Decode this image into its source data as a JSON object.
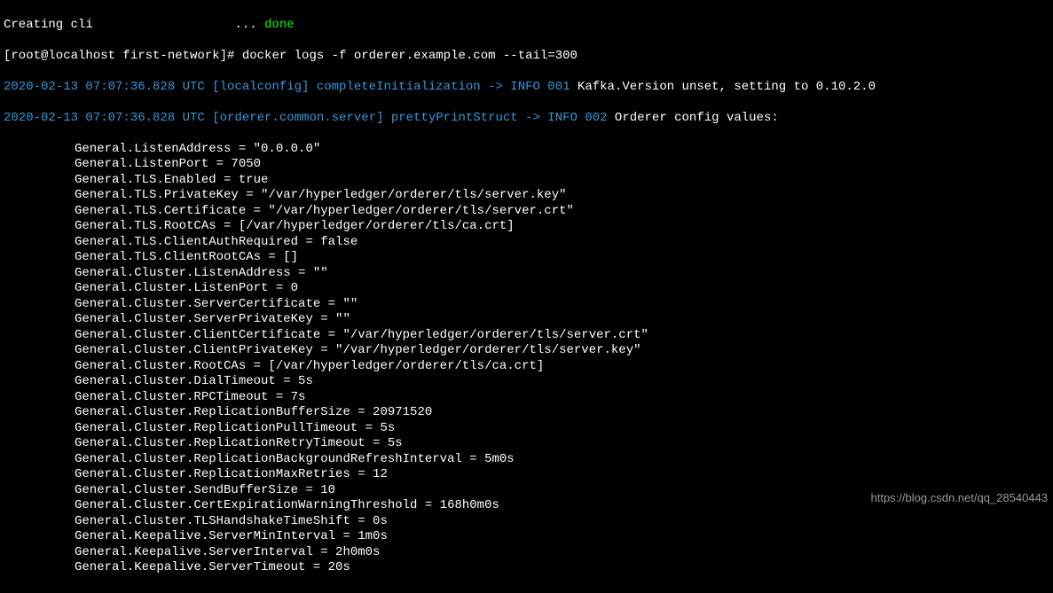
{
  "terminal": {
    "line1_part1": "Creating cli                   ... ",
    "line1_done": "done",
    "prompt": "[root@localhost first-network]# ",
    "command": "docker logs -f orderer.example.com --tail=300",
    "log1_time": "2020-02-13 07:07:36.828 UTC [localconfig] completeInitialization -> INFO 001",
    "log1_msg": " Kafka.Version unset, setting to 0.10.2.0",
    "log2_time": "2020-02-13 07:07:36.828 UTC [orderer.common.server] prettyPrintStruct -> INFO 002",
    "log2_msg": " Orderer config values:",
    "config": [
      "General.ListenAddress = \"0.0.0.0\"",
      "General.ListenPort = 7050",
      "General.TLS.Enabled = true",
      "General.TLS.PrivateKey = \"/var/hyperledger/orderer/tls/server.key\"",
      "General.TLS.Certificate = \"/var/hyperledger/orderer/tls/server.crt\"",
      "General.TLS.RootCAs = [/var/hyperledger/orderer/tls/ca.crt]",
      "General.TLS.ClientAuthRequired = false",
      "General.TLS.ClientRootCAs = []",
      "General.Cluster.ListenAddress = \"\"",
      "General.Cluster.ListenPort = 0",
      "General.Cluster.ServerCertificate = \"\"",
      "General.Cluster.ServerPrivateKey = \"\"",
      "General.Cluster.ClientCertificate = \"/var/hyperledger/orderer/tls/server.crt\"",
      "General.Cluster.ClientPrivateKey = \"/var/hyperledger/orderer/tls/server.key\"",
      "General.Cluster.RootCAs = [/var/hyperledger/orderer/tls/ca.crt]",
      "General.Cluster.DialTimeout = 5s",
      "General.Cluster.RPCTimeout = 7s",
      "General.Cluster.ReplicationBufferSize = 20971520",
      "General.Cluster.ReplicationPullTimeout = 5s",
      "General.Cluster.ReplicationRetryTimeout = 5s",
      "General.Cluster.ReplicationBackgroundRefreshInterval = 5m0s",
      "General.Cluster.ReplicationMaxRetries = 12",
      "General.Cluster.SendBufferSize = 10",
      "General.Cluster.CertExpirationWarningThreshold = 168h0m0s",
      "General.Cluster.TLSHandshakeTimeShift = 0s",
      "General.Keepalive.ServerMinInterval = 1m0s",
      "General.Keepalive.ServerInterval = 2h0m0s",
      "General.Keepalive.ServerTimeout = 20s"
    ]
  },
  "watermark": "https://blog.csdn.net/qq_28540443"
}
